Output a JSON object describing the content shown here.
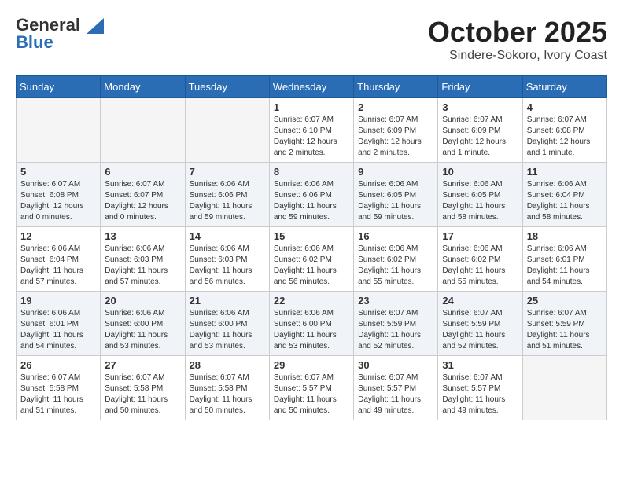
{
  "header": {
    "logo_line1": "General",
    "logo_line2": "Blue",
    "month": "October 2025",
    "location": "Sindere-Sokoro, Ivory Coast"
  },
  "weekdays": [
    "Sunday",
    "Monday",
    "Tuesday",
    "Wednesday",
    "Thursday",
    "Friday",
    "Saturday"
  ],
  "weeks": [
    [
      {
        "day": "",
        "info": ""
      },
      {
        "day": "",
        "info": ""
      },
      {
        "day": "",
        "info": ""
      },
      {
        "day": "1",
        "info": "Sunrise: 6:07 AM\nSunset: 6:10 PM\nDaylight: 12 hours and 2 minutes."
      },
      {
        "day": "2",
        "info": "Sunrise: 6:07 AM\nSunset: 6:09 PM\nDaylight: 12 hours and 2 minutes."
      },
      {
        "day": "3",
        "info": "Sunrise: 6:07 AM\nSunset: 6:09 PM\nDaylight: 12 hours and 1 minute."
      },
      {
        "day": "4",
        "info": "Sunrise: 6:07 AM\nSunset: 6:08 PM\nDaylight: 12 hours and 1 minute."
      }
    ],
    [
      {
        "day": "5",
        "info": "Sunrise: 6:07 AM\nSunset: 6:08 PM\nDaylight: 12 hours and 0 minutes."
      },
      {
        "day": "6",
        "info": "Sunrise: 6:07 AM\nSunset: 6:07 PM\nDaylight: 12 hours and 0 minutes."
      },
      {
        "day": "7",
        "info": "Sunrise: 6:06 AM\nSunset: 6:06 PM\nDaylight: 11 hours and 59 minutes."
      },
      {
        "day": "8",
        "info": "Sunrise: 6:06 AM\nSunset: 6:06 PM\nDaylight: 11 hours and 59 minutes."
      },
      {
        "day": "9",
        "info": "Sunrise: 6:06 AM\nSunset: 6:05 PM\nDaylight: 11 hours and 59 minutes."
      },
      {
        "day": "10",
        "info": "Sunrise: 6:06 AM\nSunset: 6:05 PM\nDaylight: 11 hours and 58 minutes."
      },
      {
        "day": "11",
        "info": "Sunrise: 6:06 AM\nSunset: 6:04 PM\nDaylight: 11 hours and 58 minutes."
      }
    ],
    [
      {
        "day": "12",
        "info": "Sunrise: 6:06 AM\nSunset: 6:04 PM\nDaylight: 11 hours and 57 minutes."
      },
      {
        "day": "13",
        "info": "Sunrise: 6:06 AM\nSunset: 6:03 PM\nDaylight: 11 hours and 57 minutes."
      },
      {
        "day": "14",
        "info": "Sunrise: 6:06 AM\nSunset: 6:03 PM\nDaylight: 11 hours and 56 minutes."
      },
      {
        "day": "15",
        "info": "Sunrise: 6:06 AM\nSunset: 6:02 PM\nDaylight: 11 hours and 56 minutes."
      },
      {
        "day": "16",
        "info": "Sunrise: 6:06 AM\nSunset: 6:02 PM\nDaylight: 11 hours and 55 minutes."
      },
      {
        "day": "17",
        "info": "Sunrise: 6:06 AM\nSunset: 6:02 PM\nDaylight: 11 hours and 55 minutes."
      },
      {
        "day": "18",
        "info": "Sunrise: 6:06 AM\nSunset: 6:01 PM\nDaylight: 11 hours and 54 minutes."
      }
    ],
    [
      {
        "day": "19",
        "info": "Sunrise: 6:06 AM\nSunset: 6:01 PM\nDaylight: 11 hours and 54 minutes."
      },
      {
        "day": "20",
        "info": "Sunrise: 6:06 AM\nSunset: 6:00 PM\nDaylight: 11 hours and 53 minutes."
      },
      {
        "day": "21",
        "info": "Sunrise: 6:06 AM\nSunset: 6:00 PM\nDaylight: 11 hours and 53 minutes."
      },
      {
        "day": "22",
        "info": "Sunrise: 6:06 AM\nSunset: 6:00 PM\nDaylight: 11 hours and 53 minutes."
      },
      {
        "day": "23",
        "info": "Sunrise: 6:07 AM\nSunset: 5:59 PM\nDaylight: 11 hours and 52 minutes."
      },
      {
        "day": "24",
        "info": "Sunrise: 6:07 AM\nSunset: 5:59 PM\nDaylight: 11 hours and 52 minutes."
      },
      {
        "day": "25",
        "info": "Sunrise: 6:07 AM\nSunset: 5:59 PM\nDaylight: 11 hours and 51 minutes."
      }
    ],
    [
      {
        "day": "26",
        "info": "Sunrise: 6:07 AM\nSunset: 5:58 PM\nDaylight: 11 hours and 51 minutes."
      },
      {
        "day": "27",
        "info": "Sunrise: 6:07 AM\nSunset: 5:58 PM\nDaylight: 11 hours and 50 minutes."
      },
      {
        "day": "28",
        "info": "Sunrise: 6:07 AM\nSunset: 5:58 PM\nDaylight: 11 hours and 50 minutes."
      },
      {
        "day": "29",
        "info": "Sunrise: 6:07 AM\nSunset: 5:57 PM\nDaylight: 11 hours and 50 minutes."
      },
      {
        "day": "30",
        "info": "Sunrise: 6:07 AM\nSunset: 5:57 PM\nDaylight: 11 hours and 49 minutes."
      },
      {
        "day": "31",
        "info": "Sunrise: 6:07 AM\nSunset: 5:57 PM\nDaylight: 11 hours and 49 minutes."
      },
      {
        "day": "",
        "info": ""
      }
    ]
  ]
}
